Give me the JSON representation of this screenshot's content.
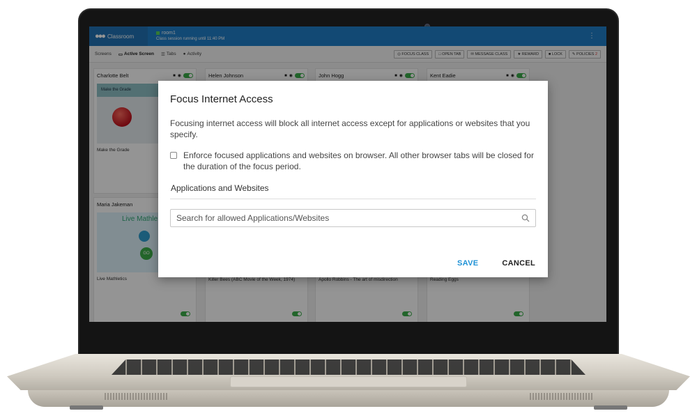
{
  "app": {
    "brand": "Classroom",
    "room_name": "room1",
    "session_status": "Class session running until 11:40 PM"
  },
  "toolbar": {
    "tabs": [
      "Screens",
      "Active Screen",
      "Tabs",
      "Activity"
    ],
    "actions": [
      "FOCUS CLASS",
      "OPEN TAB",
      "MESSAGE CLASS",
      "REWARD",
      "LOCK",
      "POLICIES"
    ],
    "policies_badge": "2"
  },
  "students": [
    {
      "name": "Charlotte Belt",
      "caption": "Make the Grade",
      "thumb_title": "Make the Grade"
    },
    {
      "name": "Helen Johnson",
      "caption": ""
    },
    {
      "name": "John Hogg",
      "caption": ""
    },
    {
      "name": "Kent Eadie",
      "caption": ""
    },
    {
      "name": "Maria Jakeman",
      "caption": "Live Mathletics",
      "thumb_title": "Live Mathle",
      "thumb_badge": "GO"
    },
    {
      "name": "",
      "caption": "Killer Bees (ABC Movie of the Week, 1974)"
    },
    {
      "name": "",
      "caption": "Apollo Robbins - The art of misdirection"
    },
    {
      "name": "",
      "caption": "Reading Eggs"
    }
  ],
  "modal": {
    "title": "Focus Internet Access",
    "description": "Focusing internet access will block all internet access except for applications or websites that you specify.",
    "enforce_label": "Enforce focused applications and websites on browser. All other browser tabs will be closed for the duration of the focus period.",
    "enforce_checked": false,
    "section_label": "Applications and Websites",
    "search_placeholder": "Search for allowed Applications/Websites",
    "save_label": "SAVE",
    "cancel_label": "CANCEL"
  },
  "colors": {
    "header_blue": "#1f7ec8",
    "accent_blue": "#1f92d6",
    "toggle_green": "#3cae4a"
  }
}
